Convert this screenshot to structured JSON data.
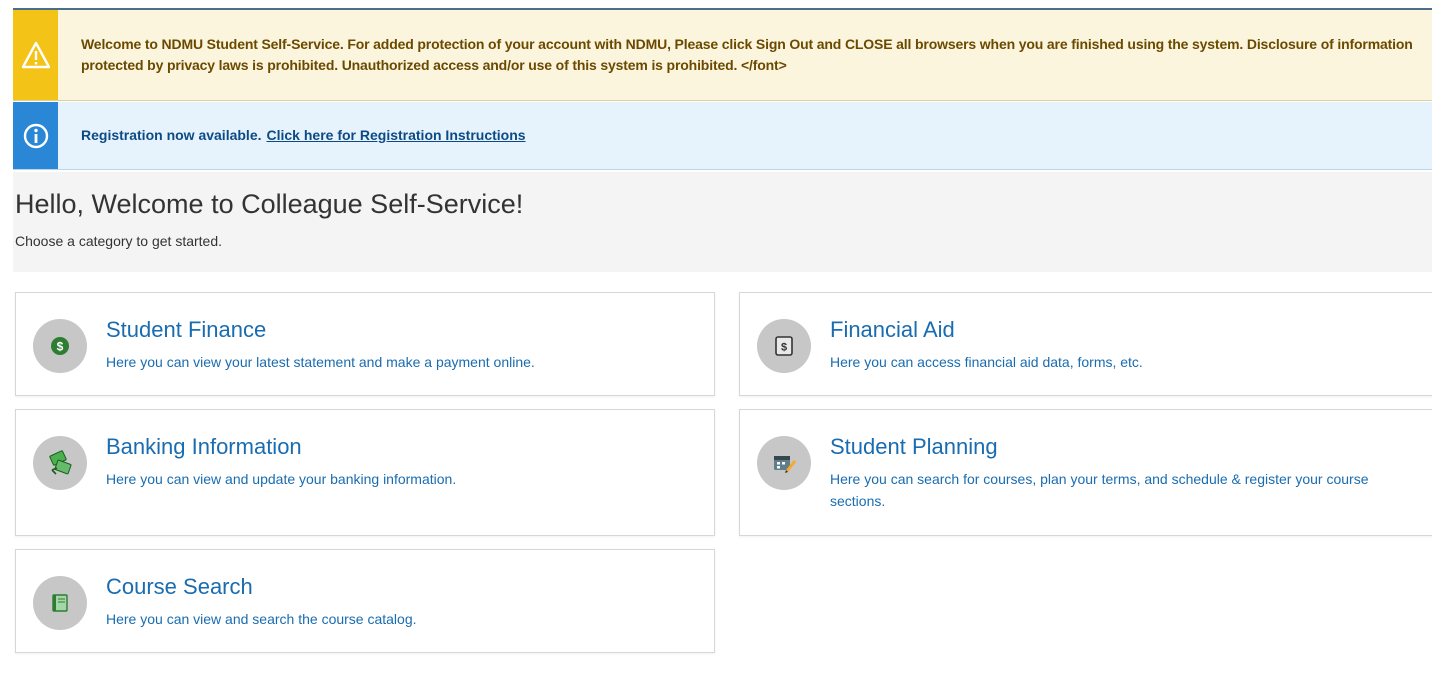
{
  "alerts": {
    "warning": {
      "icon": "warning-triangle-icon",
      "text": "Welcome to NDMU Student Self-Service. For added protection of your account with NDMU, Please click Sign Out and CLOSE all browsers when you are finished using the system. Disclosure of information protected by privacy laws is prohibited. Unauthorized access and/or use of this system is prohibited. </font>"
    },
    "info": {
      "icon": "info-circle-icon",
      "text": "Registration now available.",
      "link": "Click here for Registration Instructions"
    }
  },
  "welcome": {
    "title": "Hello, Welcome to Colleague Self-Service!",
    "subtitle": "Choose a category to get started."
  },
  "categories": [
    {
      "title": "Student Finance",
      "desc": "Here you can view your latest statement and make a payment online.",
      "icon": "dollar-coin-icon"
    },
    {
      "title": "Financial Aid",
      "desc": "Here you can access financial aid data, forms, etc.",
      "icon": "dollar-bill-icon"
    },
    {
      "title": "Banking Information",
      "desc": "Here you can view and update your banking information.",
      "icon": "money-exchange-icon"
    },
    {
      "title": "Student Planning",
      "desc": "Here you can search for courses, plan your terms, and schedule & register your course sections.",
      "icon": "calendar-pencil-icon"
    },
    {
      "title": "Course Search",
      "desc": "Here you can view and search the course catalog.",
      "icon": "book-icon"
    }
  ],
  "colors": {
    "warning_accent": "#f4c318",
    "info_accent": "#2a87d6",
    "link_blue": "#1a6cb0"
  }
}
